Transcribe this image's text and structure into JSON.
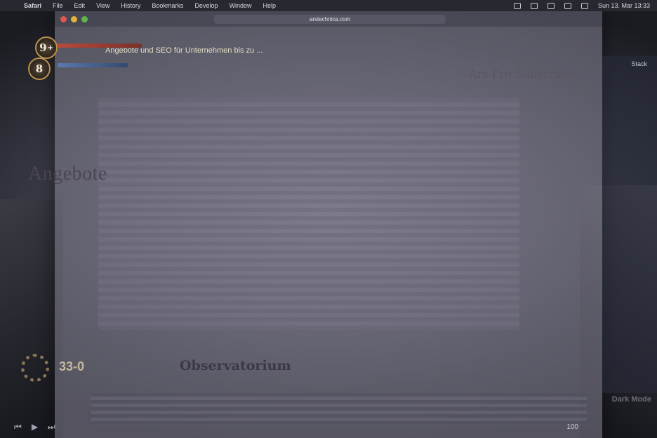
{
  "menubar": {
    "apple_icon": "apple-icon",
    "items": [
      {
        "label": "Safari",
        "app": true
      },
      {
        "label": "File"
      },
      {
        "label": "Edit"
      },
      {
        "label": "View"
      },
      {
        "label": "History"
      },
      {
        "label": "Bookmarks"
      },
      {
        "label": "Develop"
      },
      {
        "label": "Window"
      },
      {
        "label": "Help"
      }
    ],
    "clock": "Sun 13. Mar  13:33"
  },
  "browser": {
    "url": "arstechnica.com"
  },
  "hud": {
    "badge_top": "9",
    "badge_top_suffix": "+",
    "badge_bottom": "8",
    "score": "33-0"
  },
  "page": {
    "banner": "Angebote und SEO für Unternehmen bis zu ...",
    "subscriber_label": "Ars Pro Subscriber",
    "headline": "Angebote",
    "feature_title": "Observatorium",
    "side_label": "Stack",
    "right_caption": "Dark Mode",
    "zoom_label": "100"
  },
  "colors": {
    "accent_red": "#e0574f",
    "accent_yellow": "#dfb23a",
    "accent_green": "#5fb54d"
  }
}
